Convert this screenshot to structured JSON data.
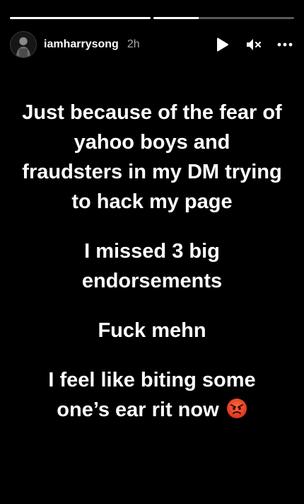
{
  "progress": {
    "segments": [
      {
        "fill": 1.0
      },
      {
        "fill": 0.32
      }
    ]
  },
  "header": {
    "username": "iamharrysong",
    "timestamp": "2h",
    "icons": [
      "play-icon",
      "mute-icon",
      "more-options-icon"
    ]
  },
  "story": {
    "paragraphs": [
      "Just because of the fear of yahoo boys and fraudsters in my DM trying to hack my page",
      "I missed 3 big endorsements",
      "Fuck mehn",
      "I feel like biting some one’s ear rit now"
    ],
    "emoji": "angry-face-icon"
  },
  "colors": {
    "background": "#000000",
    "text": "#ffffff",
    "emoji": "#e8452c"
  }
}
